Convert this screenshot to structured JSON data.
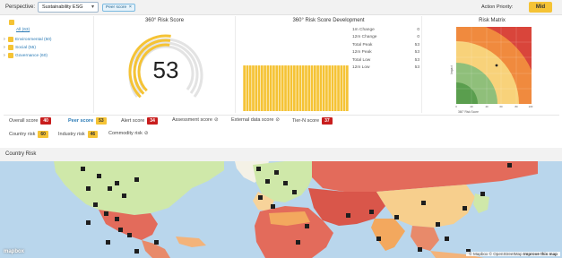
{
  "topbar": {
    "perspective_label": "Perspective:",
    "perspective_value": "Sustainability ESG",
    "filter_chip": "Peer score",
    "action_priority_label": "Action Priority:",
    "action_priority_value": "Mid"
  },
  "tree": {
    "items": [
      {
        "label": "All (63)",
        "expandable": false
      },
      {
        "label": "Environmental (50)",
        "expandable": true
      },
      {
        "label": "Social (55)",
        "expandable": true
      },
      {
        "label": "Governance (60)",
        "expandable": true
      }
    ]
  },
  "risk_score": {
    "title": "360° Risk Score",
    "value": "53"
  },
  "development": {
    "title": "360° Risk Score Development",
    "stats": [
      {
        "label": "1m Change",
        "value": "0"
      },
      {
        "label": "12m Change",
        "value": "0"
      },
      {
        "label": "Total Peak",
        "value": "53"
      },
      {
        "label": "12m Peak",
        "value": "53"
      },
      {
        "label": "Total Low",
        "value": "53"
      },
      {
        "label": "12m Low",
        "value": "53"
      }
    ]
  },
  "risk_matrix": {
    "title": "Risk Matrix",
    "ylabel": "Impact",
    "xlabel": "360° Risk Score",
    "tick_labels": [
      "0",
      "20",
      "40",
      "60",
      "80",
      "100"
    ]
  },
  "scores": {
    "overall": {
      "label": "Overall score",
      "value": "40",
      "color": "#c81d1d"
    },
    "peer": {
      "label": "Peer score",
      "value": "53",
      "color": "#f5c335"
    },
    "alert": {
      "label": "Alert score",
      "value": "34",
      "color": "#c81d1d"
    },
    "assessment": {
      "label": "Assessment score"
    },
    "external": {
      "label": "External data score"
    },
    "tiern": {
      "label": "Tier-N score",
      "value": "37",
      "color": "#c81d1d"
    },
    "country": {
      "label": "Country risk",
      "value": "60",
      "color": "#f5c335"
    },
    "industry": {
      "label": "Industry risk",
      "value": "46",
      "color": "#f5c335"
    },
    "commodity": {
      "label": "Commodity risk"
    }
  },
  "country_risk": {
    "title": "Country Risk",
    "logo": "mapbox",
    "attribution_mapbox": "© Mapbox",
    "attribution_osm": "© OpenStreetMap",
    "attribution_improve": "Improve this map"
  }
}
